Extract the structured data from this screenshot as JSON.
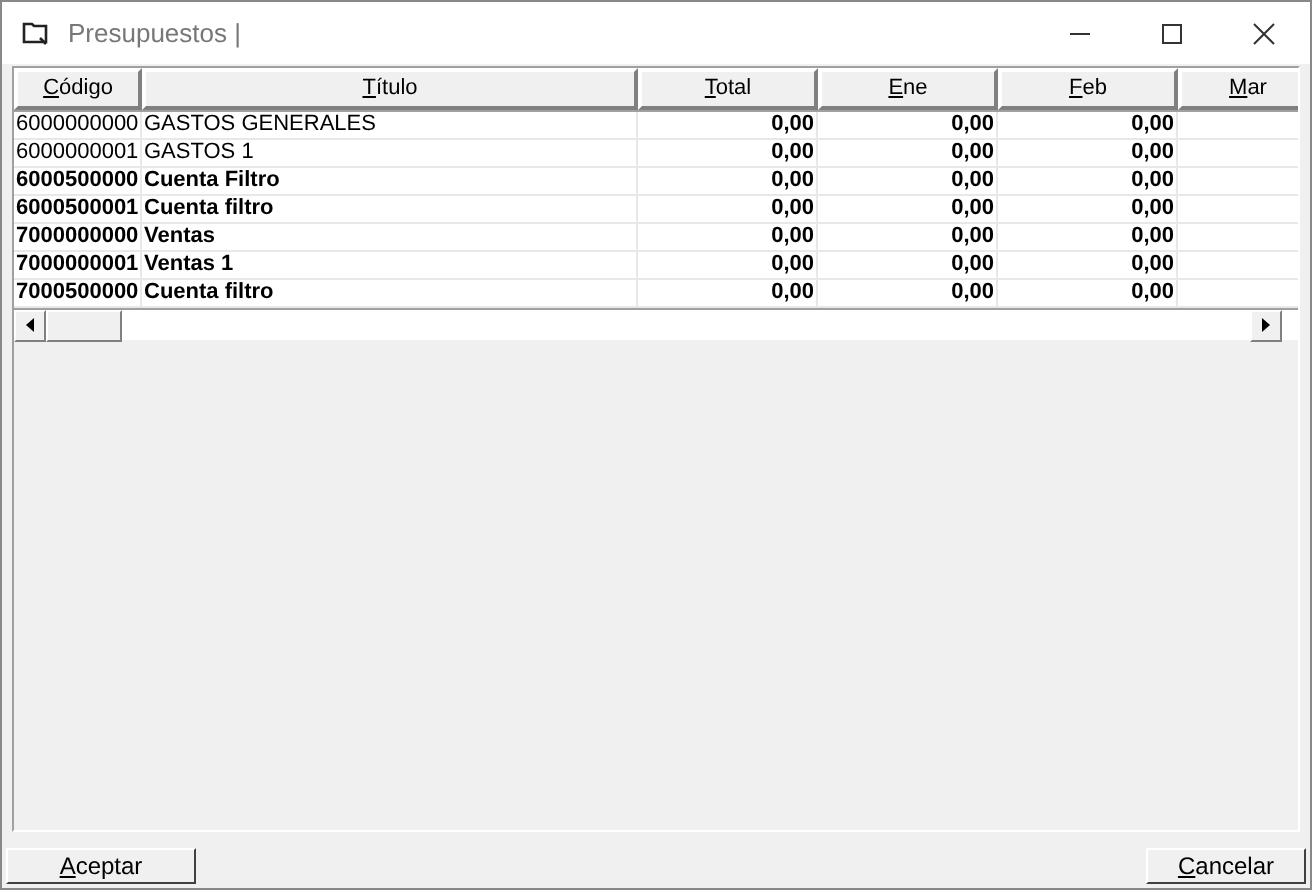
{
  "window": {
    "title": "Presupuestos |"
  },
  "table": {
    "columns": [
      "Código",
      "Título",
      "Total",
      "Ene",
      "Feb",
      "Mar"
    ],
    "rows": [
      {
        "bold": false,
        "cells": [
          "6000000000",
          "GASTOS GENERALES",
          "0,00",
          "0,00",
          "0,00"
        ]
      },
      {
        "bold": false,
        "cells": [
          "6000000001",
          "GASTOS 1",
          "0,00",
          "0,00",
          "0,00"
        ]
      },
      {
        "bold": true,
        "cells": [
          "6000500000",
          "Cuenta Filtro",
          "0,00",
          "0,00",
          "0,00"
        ]
      },
      {
        "bold": true,
        "cells": [
          "6000500001",
          "Cuenta filtro",
          "0,00",
          "0,00",
          "0,00"
        ]
      },
      {
        "bold": true,
        "cells": [
          "7000000000",
          "Ventas",
          "0,00",
          "0,00",
          "0,00"
        ]
      },
      {
        "bold": true,
        "cells": [
          "7000000001",
          "Ventas 1",
          "0,00",
          "0,00",
          "0,00"
        ]
      },
      {
        "bold": true,
        "cells": [
          "7000500000",
          "Cuenta filtro",
          "0,00",
          "0,00",
          "0,00"
        ]
      }
    ]
  },
  "buttons": [
    "Aceptar",
    "Cancelar"
  ]
}
